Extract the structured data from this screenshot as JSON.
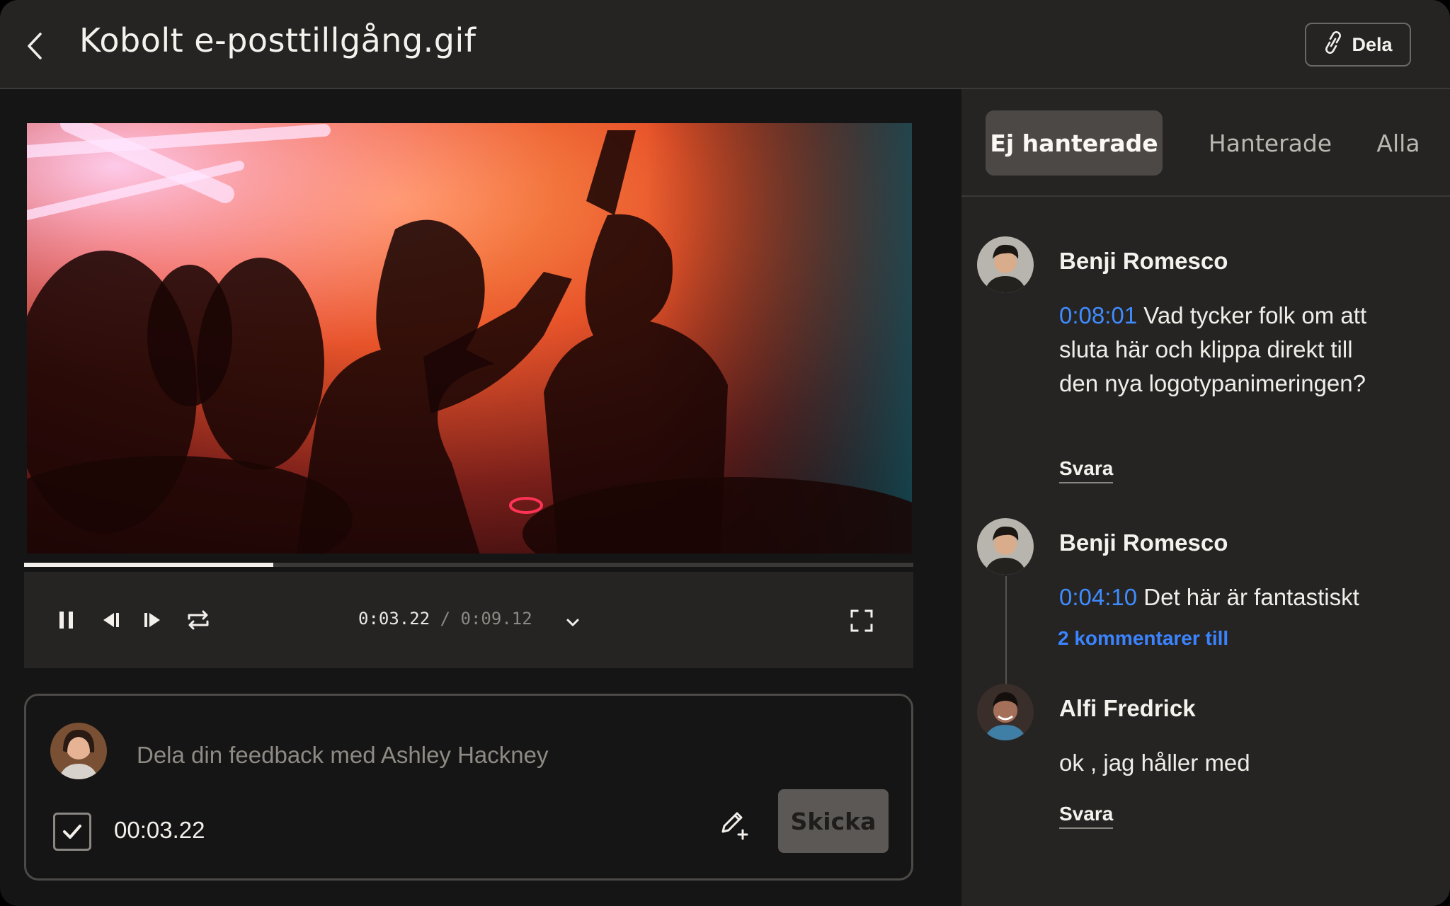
{
  "header": {
    "title": "Kobolt e-posttillgång.gif",
    "share_label": "Dela"
  },
  "player": {
    "current_time": "0:03.22",
    "separator": "/",
    "duration": "0:09.12",
    "progress": 0.28
  },
  "composer": {
    "placeholder": "Dela din feedback med Ashley Hackney",
    "timestamp": "00:03.22",
    "timestamp_checked": true,
    "send_label": "Skicka"
  },
  "tabs": [
    {
      "label": "Ej hanterade",
      "active": true
    },
    {
      "label": "Hanterade",
      "active": false
    },
    {
      "label": "Alla",
      "active": false
    }
  ],
  "comments": [
    {
      "author": "Benji Romesco",
      "timestamp": "0:08:01",
      "text": "Vad tycker folk om att sluta här och klippa direkt till den nya logotypanimeringen?",
      "reply_label": "Svara"
    },
    {
      "author": "Benji Romesco",
      "timestamp": "0:04:10",
      "text": "Det här är fantastiskt",
      "more_label": "2 kommentarer till"
    },
    {
      "author": "Alfi Fredrick",
      "text": "ok , jag håller med",
      "reply_label": "Svara"
    }
  ],
  "colors": {
    "accent_blue": "#3f8cff",
    "panel_bg": "#252423",
    "app_bg": "#161515"
  }
}
